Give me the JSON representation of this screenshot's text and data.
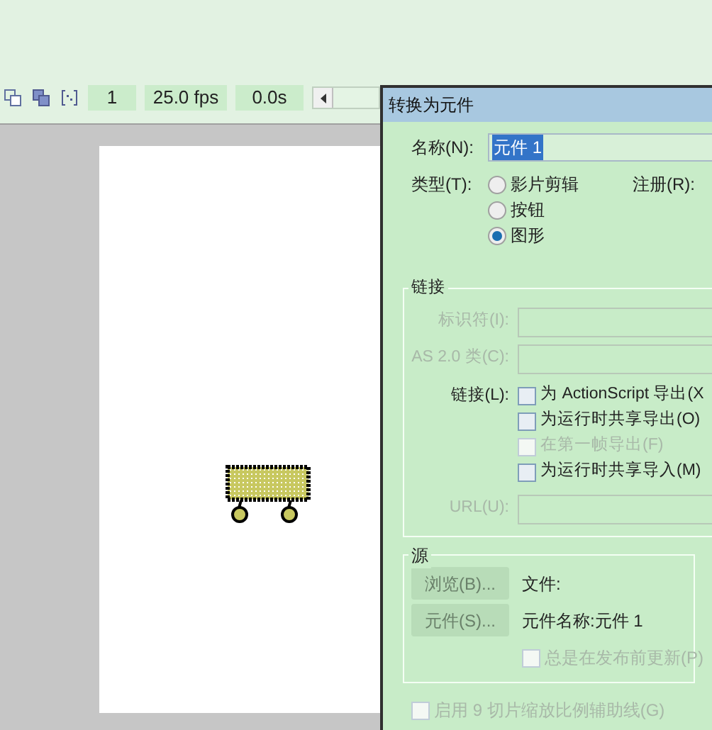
{
  "timeline": {
    "frame": "1",
    "fps": "25.0 fps",
    "time": "0.0s"
  },
  "dialog": {
    "title": "转换为元件",
    "name": {
      "label": "名称(N):",
      "value": "元件 1"
    },
    "type": {
      "label": "类型(T):",
      "registration_label": "注册(R):",
      "options": [
        {
          "label": "影片剪辑",
          "selected": false
        },
        {
          "label": "按钮",
          "selected": false
        },
        {
          "label": "图形",
          "selected": true
        }
      ]
    },
    "linkage": {
      "legend": "链接",
      "identifier": {
        "label": "标识符(I):",
        "disabled": true
      },
      "as_class": {
        "label": "AS 2.0 类(C):",
        "disabled": true
      },
      "linkage_label": "链接(L):",
      "checkboxes": [
        {
          "label": "为 ActionScript 导出(X",
          "checked": false,
          "disabled": false
        },
        {
          "label": "为运行时共享导出(O)",
          "checked": false,
          "disabled": false
        },
        {
          "label": "在第一帧导出(F)",
          "checked": false,
          "disabled": true
        },
        {
          "label": "为运行时共享导入(M)",
          "checked": false,
          "disabled": false
        }
      ],
      "url": {
        "label": "URL(U):",
        "disabled": true
      }
    },
    "source": {
      "legend": "源",
      "buttons": [
        {
          "label": "浏览(B)...",
          "disabled": true,
          "info": "文件:"
        },
        {
          "label": "元件(S)...",
          "disabled": true,
          "info": "元件名称:元件 1"
        }
      ],
      "update": {
        "label": "总是在发布前更新(P)",
        "checked": false,
        "disabled": true
      }
    },
    "nine_slice": {
      "label": "启用 9 切片缩放比例辅助线(G)",
      "checked": false,
      "disabled": true
    }
  }
}
